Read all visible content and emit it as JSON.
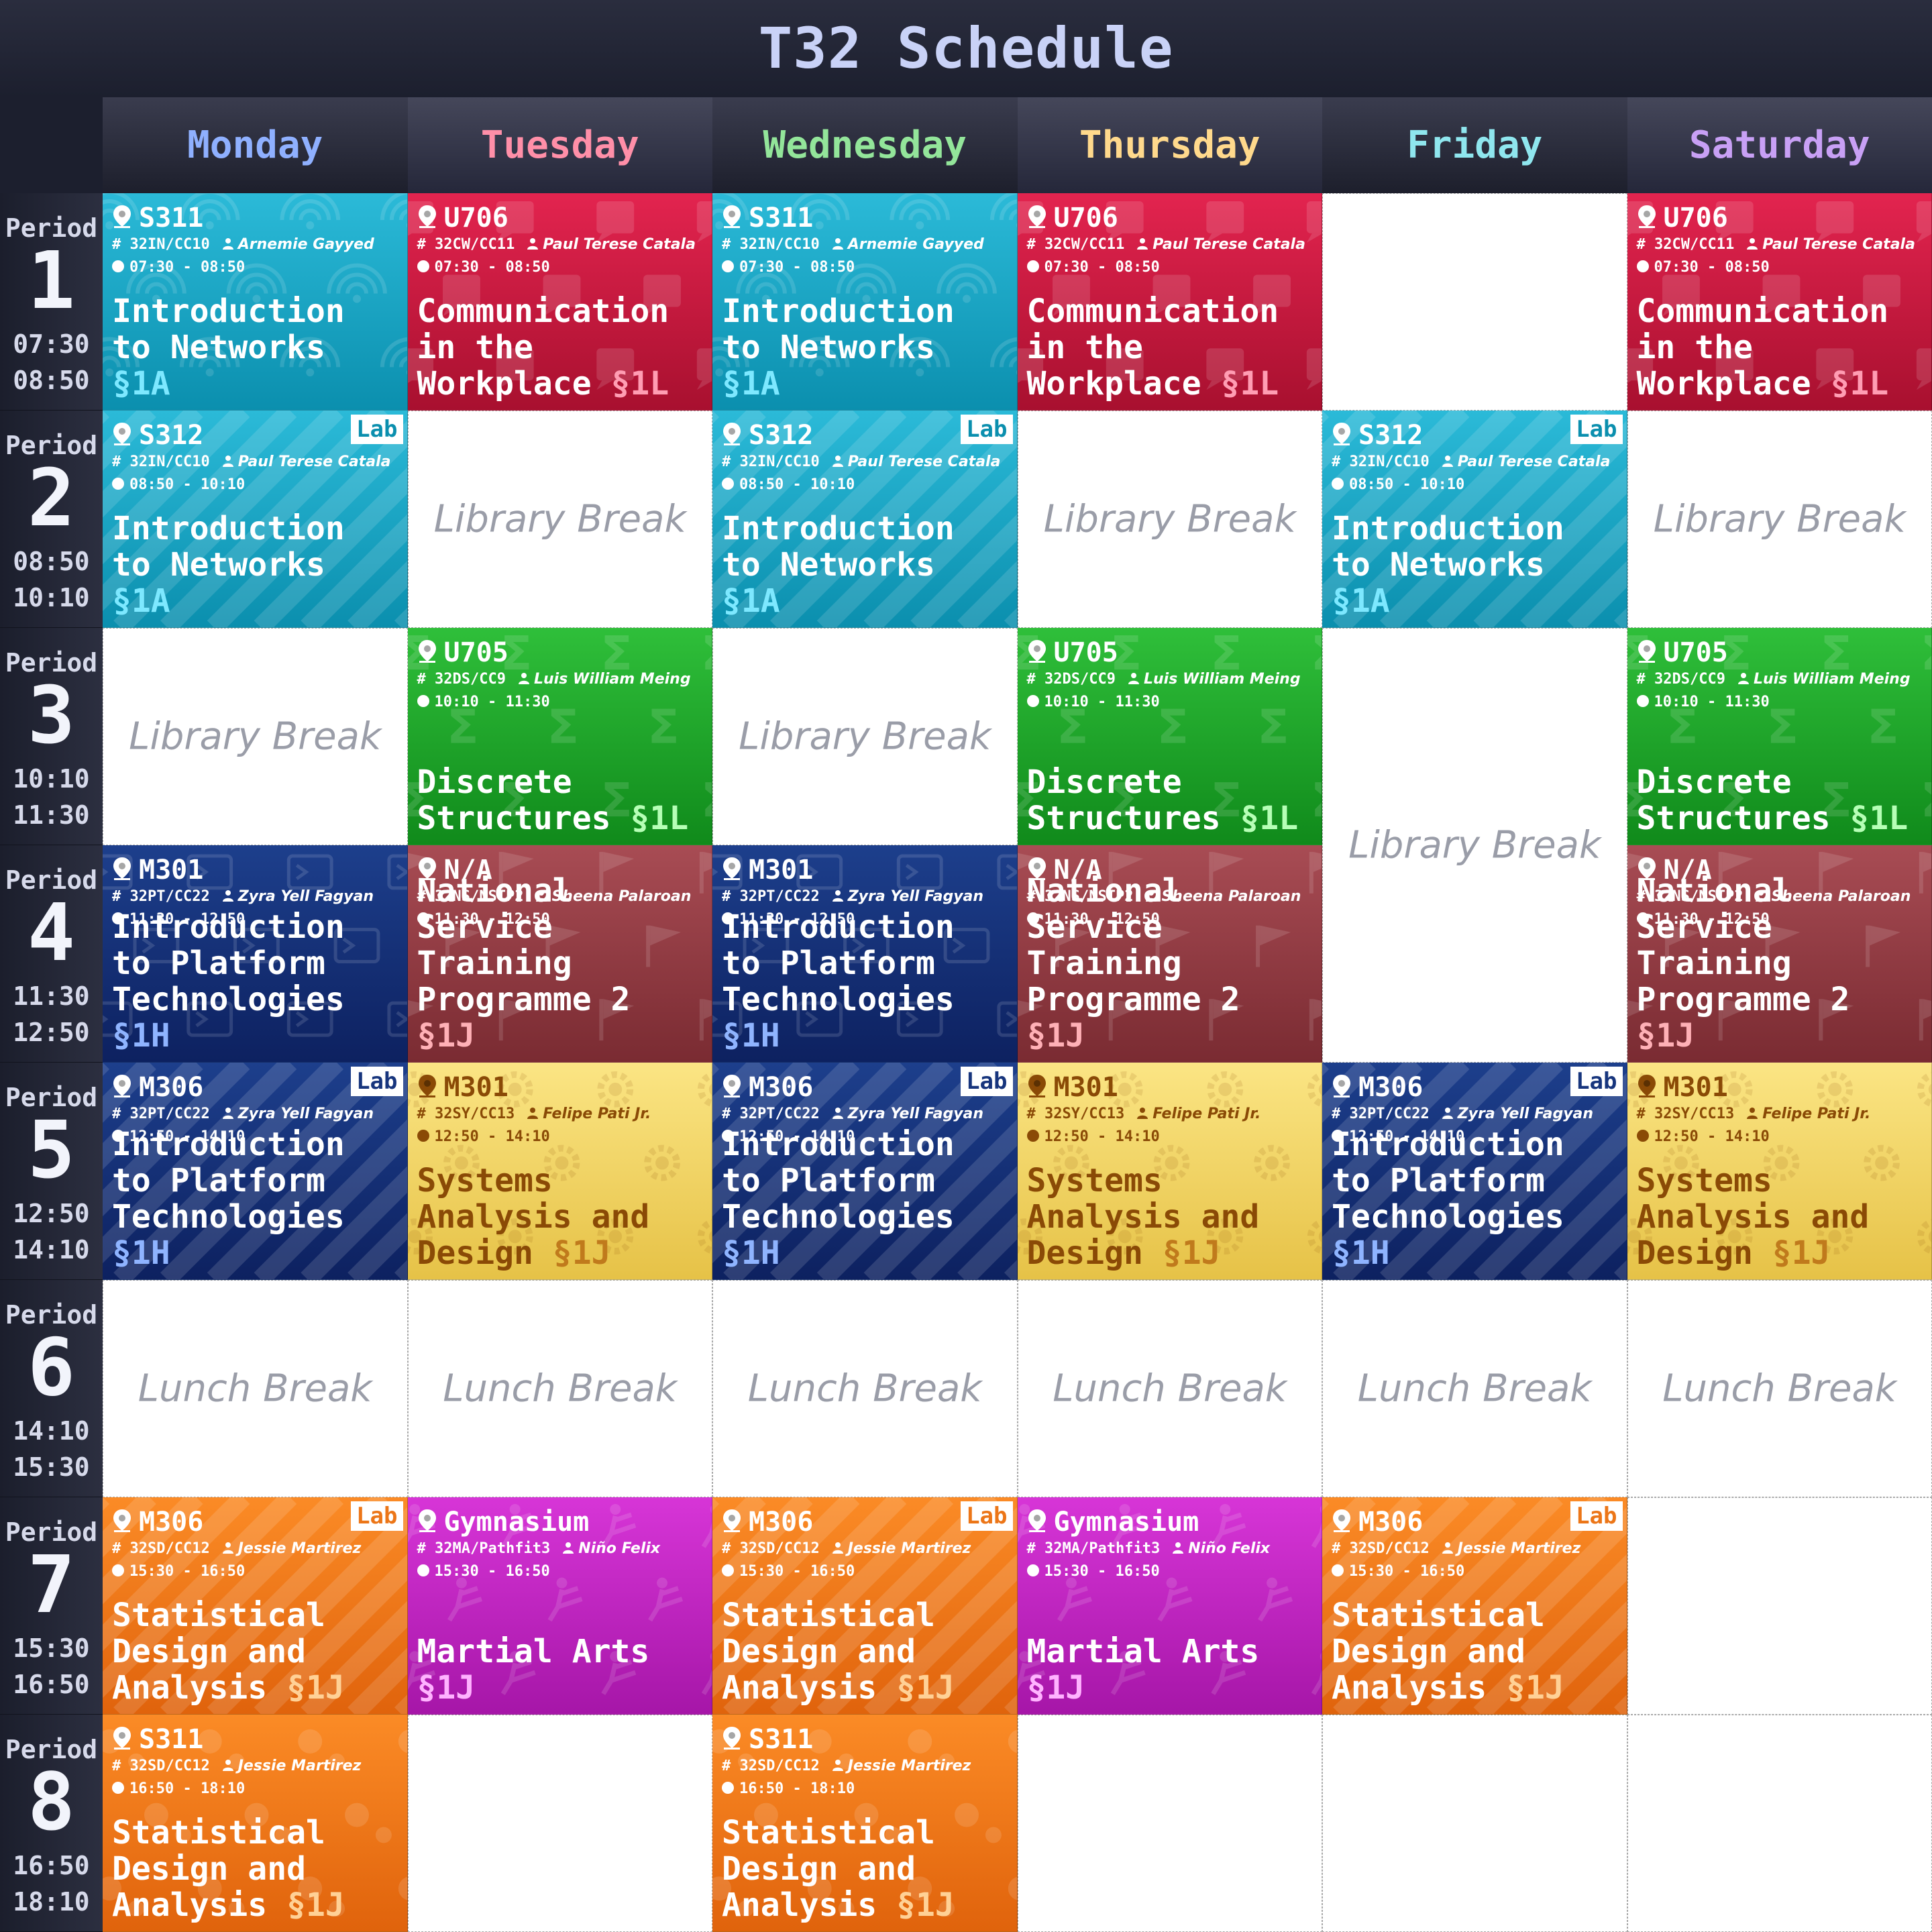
{
  "title": "T32 Schedule",
  "days": [
    {
      "label": "Monday",
      "color": "#8fb0ff"
    },
    {
      "label": "Tuesday",
      "color": "#ff8fa8"
    },
    {
      "label": "Wednesday",
      "color": "#93e59a"
    },
    {
      "label": "Thursday",
      "color": "#ffd98c"
    },
    {
      "label": "Friday",
      "color": "#8fe6ee"
    },
    {
      "label": "Saturday",
      "color": "#c8a0f5"
    }
  ],
  "periods": [
    {
      "label": "Period",
      "num": "1",
      "start": "07:30",
      "end": "08:50"
    },
    {
      "label": "Period",
      "num": "2",
      "start": "08:50",
      "end": "10:10"
    },
    {
      "label": "Period",
      "num": "3",
      "start": "10:10",
      "end": "11:30"
    },
    {
      "label": "Period",
      "num": "4",
      "start": "11:30",
      "end": "12:50"
    },
    {
      "label": "Period",
      "num": "5",
      "start": "12:50",
      "end": "14:10"
    },
    {
      "label": "Period",
      "num": "6",
      "start": "14:10",
      "end": "15:30"
    },
    {
      "label": "Period",
      "num": "7",
      "start": "15:30",
      "end": "16:50"
    },
    {
      "label": "Period",
      "num": "8",
      "start": "16:50",
      "end": "18:10"
    }
  ],
  "courses": {
    "net": {
      "name": "Introduction to Networks",
      "sec": "§1A",
      "code": "32IN/CC10",
      "color": "cyan",
      "icon": "wifi"
    },
    "com": {
      "name": "Communication in the Workplace",
      "sec": "§1L",
      "code": "32CW/CC11",
      "color": "red",
      "icon": "chat"
    },
    "dis": {
      "name": "Discrete Structures",
      "sec": "§1L",
      "code": "32DS/CC9",
      "color": "green",
      "icon": "sigma"
    },
    "plat": {
      "name": "Introduction to Platform Technologies",
      "sec": "§1H",
      "code": "32PT/CC22",
      "color": "navy",
      "icon": "terminal"
    },
    "nstp": {
      "name": "National Service Training Programme 2",
      "sec": "§1J",
      "code": "32NS/NSTP2",
      "color": "maroon",
      "icon": "flag"
    },
    "sad": {
      "name": "Systems Analysis and Design",
      "sec": "§1J",
      "code": "32SY/CC13",
      "color": "yellow",
      "icon": "gear"
    },
    "stat": {
      "name": "Statistical Design and Analysis",
      "sec": "§1J",
      "code": "32SD/CC12",
      "color": "orange",
      "icon": "dots"
    },
    "ma": {
      "name": "Martial Arts",
      "sec": "§1J",
      "code": "32MA/Pathfit3",
      "color": "magenta",
      "icon": "kick"
    }
  },
  "schedule": [
    [
      {
        "type": "class",
        "course": "net",
        "room": "S311",
        "teacher": "Arnemie Gayyed",
        "time": "07:30 - 08:50"
      },
      {
        "type": "class",
        "course": "net",
        "room": "S312",
        "teacher": "Paul Terese Catala",
        "time": "08:50 - 10:10",
        "lab": "Lab"
      },
      {
        "type": "break",
        "label": "Library Break"
      },
      {
        "type": "class",
        "course": "plat",
        "room": "M301",
        "teacher": "Zyra Yell Fagyan",
        "time": "11:30 - 12:50"
      },
      {
        "type": "class",
        "course": "plat",
        "room": "M306",
        "teacher": "Zyra Yell Fagyan",
        "time": "12:50 - 14:10",
        "lab": "Lab"
      },
      {
        "type": "break",
        "label": "Lunch Break"
      },
      {
        "type": "class",
        "course": "stat",
        "room": "M306",
        "teacher": "Jessie Martirez",
        "time": "15:30 - 16:50",
        "lab": "Lab"
      },
      {
        "type": "class",
        "course": "stat",
        "room": "S311",
        "teacher": "Jessie Martirez",
        "time": "16:50 - 18:10"
      }
    ],
    [
      {
        "type": "class",
        "course": "com",
        "room": "U706",
        "teacher": "Paul Terese Catala",
        "time": "07:30 - 08:50"
      },
      {
        "type": "break",
        "label": "Library Break"
      },
      {
        "type": "class",
        "course": "dis",
        "room": "U705",
        "teacher": "Luis William Meing",
        "time": "10:10 - 11:30"
      },
      {
        "type": "class",
        "course": "nstp",
        "room": "N/A",
        "teacher": "Sheena Palaroan",
        "time": "11:30 - 12:50"
      },
      {
        "type": "class",
        "course": "sad",
        "room": "M301",
        "teacher": "Felipe Pati Jr.",
        "time": "12:50 - 14:10"
      },
      {
        "type": "break",
        "label": "Lunch Break"
      },
      {
        "type": "class",
        "course": "ma",
        "room": "Gymnasium",
        "teacher": "Niño Felix",
        "time": "15:30 - 16:50"
      },
      {
        "type": "empty"
      }
    ],
    [
      {
        "type": "class",
        "course": "net",
        "room": "S311",
        "teacher": "Arnemie Gayyed",
        "time": "07:30 - 08:50"
      },
      {
        "type": "class",
        "course": "net",
        "room": "S312",
        "teacher": "Paul Terese Catala",
        "time": "08:50 - 10:10",
        "lab": "Lab"
      },
      {
        "type": "break",
        "label": "Library Break"
      },
      {
        "type": "class",
        "course": "plat",
        "room": "M301",
        "teacher": "Zyra Yell Fagyan",
        "time": "11:30 - 12:50"
      },
      {
        "type": "class",
        "course": "plat",
        "room": "M306",
        "teacher": "Zyra Yell Fagyan",
        "time": "12:50 - 14:10",
        "lab": "Lab"
      },
      {
        "type": "break",
        "label": "Lunch Break"
      },
      {
        "type": "class",
        "course": "stat",
        "room": "M306",
        "teacher": "Jessie Martirez",
        "time": "15:30 - 16:50",
        "lab": "Lab"
      },
      {
        "type": "class",
        "course": "stat",
        "room": "S311",
        "teacher": "Jessie Martirez",
        "time": "16:50 - 18:10"
      }
    ],
    [
      {
        "type": "class",
        "course": "com",
        "room": "U706",
        "teacher": "Paul Terese Catala",
        "time": "07:30 - 08:50"
      },
      {
        "type": "break",
        "label": "Library Break"
      },
      {
        "type": "class",
        "course": "dis",
        "room": "U705",
        "teacher": "Luis William Meing",
        "time": "10:10 - 11:30"
      },
      {
        "type": "class",
        "course": "nstp",
        "room": "N/A",
        "teacher": "Sheena Palaroan",
        "time": "11:30 - 12:50"
      },
      {
        "type": "class",
        "course": "sad",
        "room": "M301",
        "teacher": "Felipe Pati Jr.",
        "time": "12:50 - 14:10"
      },
      {
        "type": "break",
        "label": "Lunch Break"
      },
      {
        "type": "class",
        "course": "ma",
        "room": "Gymnasium",
        "teacher": "Niño Felix",
        "time": "15:30 - 16:50"
      },
      {
        "type": "empty"
      }
    ],
    [
      {
        "type": "empty"
      },
      {
        "type": "class",
        "course": "net",
        "room": "S312",
        "teacher": "Paul Terese Catala",
        "time": "08:50 - 10:10",
        "lab": "Lab"
      },
      {
        "type": "break",
        "label": "Library Break",
        "span": 2
      },
      {
        "type": "skip"
      },
      {
        "type": "class",
        "course": "plat",
        "room": "M306",
        "teacher": "Zyra Yell Fagyan",
        "time": "12:50 - 14:10",
        "lab": "Lab"
      },
      {
        "type": "break",
        "label": "Lunch Break"
      },
      {
        "type": "class",
        "course": "stat",
        "room": "M306",
        "teacher": "Jessie Martirez",
        "time": "15:30 - 16:50",
        "lab": "Lab"
      },
      {
        "type": "empty"
      }
    ],
    [
      {
        "type": "class",
        "course": "com",
        "room": "U706",
        "teacher": "Paul Terese Catala",
        "time": "07:30 - 08:50"
      },
      {
        "type": "break",
        "label": "Library Break"
      },
      {
        "type": "class",
        "course": "dis",
        "room": "U705",
        "teacher": "Luis William Meing",
        "time": "10:10 - 11:30"
      },
      {
        "type": "class",
        "course": "nstp",
        "room": "N/A",
        "teacher": "Sheena Palaroan",
        "time": "11:30 - 12:50"
      },
      {
        "type": "class",
        "course": "sad",
        "room": "M301",
        "teacher": "Felipe Pati Jr.",
        "time": "12:50 - 14:10"
      },
      {
        "type": "break",
        "label": "Lunch Break"
      },
      {
        "type": "empty"
      },
      {
        "type": "empty"
      }
    ]
  ],
  "colors": {
    "cyan": {
      "top": "#2bbad8",
      "bottom": "#0b8fae",
      "text": "#ffffff",
      "sec": "#7de8ff",
      "lab": "#0b8fae"
    },
    "red": {
      "top": "#e3244f",
      "bottom": "#a8102f",
      "text": "#ffffff",
      "sec": "#ff9db3",
      "lab": "#c81c44"
    },
    "green": {
      "top": "#2fbf3a",
      "bottom": "#108a1b",
      "text": "#ffffff",
      "sec": "#b6ffb6",
      "lab": "#139a20"
    },
    "navy": {
      "top": "#1d3f8c",
      "bottom": "#0d2160",
      "text": "#ffffff",
      "sec": "#8fb4ff",
      "lab": "#17357d"
    },
    "maroon": {
      "top": "#a84c54",
      "bottom": "#7a2b32",
      "text": "#ffffff",
      "sec": "#ffb0b6",
      "lab": "#8c3a42"
    },
    "yellow": {
      "top": "#fbe584",
      "bottom": "#e6c247",
      "text": "#8a4a06",
      "sec": "#c07a1c",
      "lab": "#d4a830"
    },
    "orange": {
      "top": "#fb8b26",
      "bottom": "#e0630c",
      "text": "#ffffff",
      "sec": "#ffd196",
      "lab": "#ec7618"
    },
    "magenta": {
      "top": "#d735d7",
      "bottom": "#a616a8",
      "text": "#ffffff",
      "sec": "#ffb2ff",
      "lab": "#b520b5"
    }
  }
}
